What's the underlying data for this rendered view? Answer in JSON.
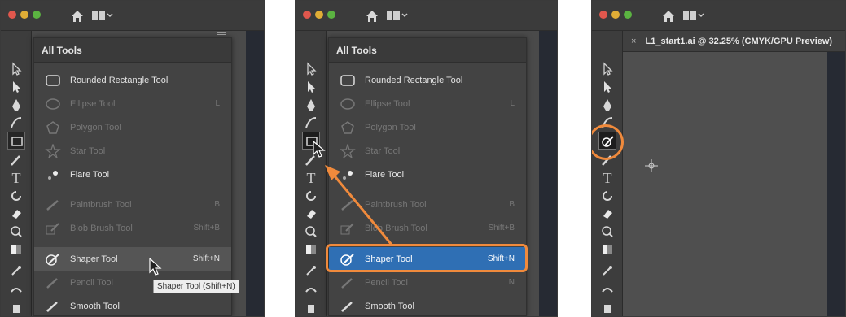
{
  "panels": [
    {
      "flyout_title": "All Tools",
      "items": [
        {
          "label": "Rounded Rectangle Tool",
          "shortcut": ""
        },
        {
          "label": "Ellipse Tool",
          "shortcut": "L"
        },
        {
          "label": "Polygon Tool",
          "shortcut": ""
        },
        {
          "label": "Star Tool",
          "shortcut": ""
        },
        {
          "label": "Flare Tool",
          "shortcut": ""
        },
        {
          "label": "Paintbrush Tool",
          "shortcut": "B"
        },
        {
          "label": "Blob Brush Tool",
          "shortcut": "Shift+B"
        },
        {
          "label": "Shaper Tool",
          "shortcut": "Shift+N"
        },
        {
          "label": "Pencil Tool",
          "shortcut": ""
        },
        {
          "label": "Smooth Tool",
          "shortcut": ""
        }
      ],
      "tooltip": "Shaper Tool (Shift+N)"
    },
    {
      "flyout_title": "All Tools",
      "items": [
        {
          "label": "Rounded Rectangle Tool",
          "shortcut": ""
        },
        {
          "label": "Ellipse Tool",
          "shortcut": "L"
        },
        {
          "label": "Polygon Tool",
          "shortcut": ""
        },
        {
          "label": "Star Tool",
          "shortcut": ""
        },
        {
          "label": "Flare Tool",
          "shortcut": ""
        },
        {
          "label": "Paintbrush Tool",
          "shortcut": "B"
        },
        {
          "label": "Blob Brush Tool",
          "shortcut": "Shift+B"
        },
        {
          "label": "Shaper Tool",
          "shortcut": "Shift+N"
        },
        {
          "label": "Pencil Tool",
          "shortcut": "N"
        },
        {
          "label": "Smooth Tool",
          "shortcut": ""
        }
      ]
    },
    {
      "doc_tab_close": "×",
      "doc_tab_title": "L1_start1.ai @ 32.25% (CMYK/GPU Preview)"
    }
  ],
  "colors": {
    "highlight": "#f08a3c",
    "selection": "#2f6fb4"
  }
}
